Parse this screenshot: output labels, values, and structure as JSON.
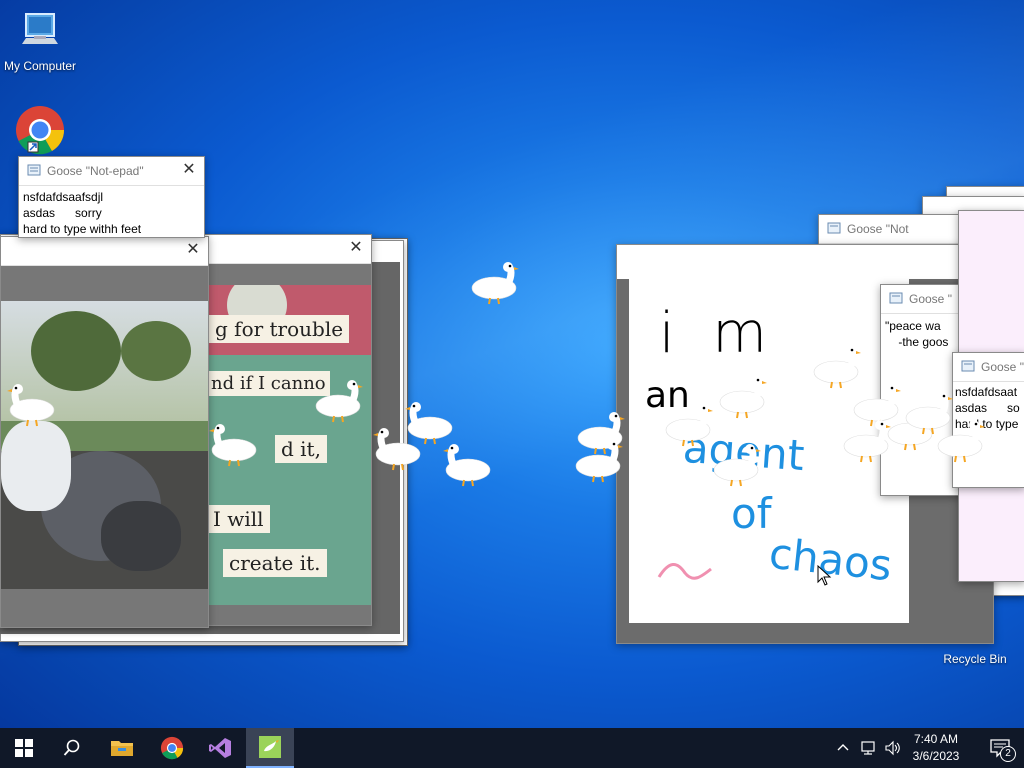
{
  "desktop": {
    "icons": [
      {
        "label": "My Computer",
        "icon": "computer-icon"
      },
      {
        "label": "",
        "icon": "chrome-icon"
      },
      {
        "label": "Recycle Bin",
        "icon": "recycle-bin-icon"
      }
    ]
  },
  "windows": {
    "notepad_main": {
      "title": "Goose \"Not-epad\"",
      "lines": [
        "nsfdafdsaafsdjl",
        "asdas      sorry",
        "hard to type withh feet"
      ]
    },
    "notepad_right_1": {
      "title": "Goose \"Not"
    },
    "notepad_right_2": {
      "title": "Goose \"",
      "lines": [
        "\"peace wa",
        "    -the goos"
      ]
    },
    "notepad_right_3": {
      "title": "Goose \"",
      "lines": [
        "nsfdafdsaat",
        "asdas      so",
        "hard to type"
      ]
    },
    "meme": {
      "lines": [
        "g for trouble",
        "nd if I canno",
        "d it,",
        "I will",
        "create it."
      ]
    },
    "drawing": {
      "words": [
        "i m",
        "an",
        "agent",
        "of",
        "chaos"
      ]
    }
  },
  "taskbar": {
    "time": "7:40 AM",
    "date": "3/6/2023",
    "notification_count": "2",
    "apps": [
      "start-icon",
      "search-icon",
      "file-explorer-icon",
      "chrome-icon",
      "visual-studio-icon",
      "goose-app-icon"
    ]
  },
  "colors": {
    "taskbar": "#101828",
    "desktop_accent": "#1a7ae6",
    "pen_blue": "#1e90e0",
    "pen_pink": "#f090b0"
  }
}
